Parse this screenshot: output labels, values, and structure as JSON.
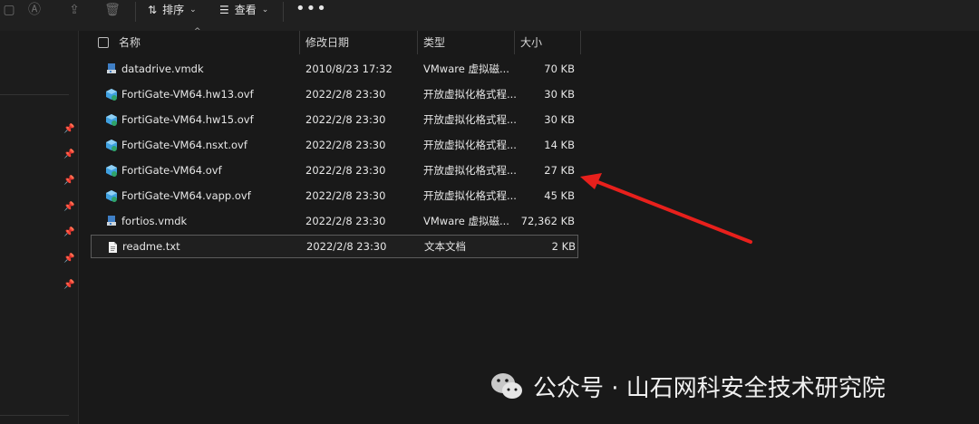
{
  "toolbar": {
    "sort_label": "排序",
    "view_label": "查看",
    "more_label": "•••"
  },
  "columns": {
    "name": "名称",
    "date": "修改日期",
    "type": "类型",
    "size": "大小"
  },
  "files": [
    {
      "name": "datadrive.vmdk",
      "date": "2010/8/23 17:32",
      "type": "VMware 虚拟磁...",
      "size": "70 KB",
      "icon": "vmdk-file-icon"
    },
    {
      "name": "FortiGate-VM64.hw13.ovf",
      "date": "2022/2/8 23:30",
      "type": "开放虚拟化格式程...",
      "size": "30 KB",
      "icon": "ovf-file-icon"
    },
    {
      "name": "FortiGate-VM64.hw15.ovf",
      "date": "2022/2/8 23:30",
      "type": "开放虚拟化格式程...",
      "size": "30 KB",
      "icon": "ovf-file-icon"
    },
    {
      "name": "FortiGate-VM64.nsxt.ovf",
      "date": "2022/2/8 23:30",
      "type": "开放虚拟化格式程...",
      "size": "14 KB",
      "icon": "ovf-file-icon"
    },
    {
      "name": "FortiGate-VM64.ovf",
      "date": "2022/2/8 23:30",
      "type": "开放虚拟化格式程...",
      "size": "27 KB",
      "icon": "ovf-file-icon"
    },
    {
      "name": "FortiGate-VM64.vapp.ovf",
      "date": "2022/2/8 23:30",
      "type": "开放虚拟化格式程...",
      "size": "45 KB",
      "icon": "ovf-file-icon"
    },
    {
      "name": "fortios.vmdk",
      "date": "2022/2/8 23:30",
      "type": "VMware 虚拟磁...",
      "size": "72,362 KB",
      "icon": "vmdk-file-icon"
    },
    {
      "name": "readme.txt",
      "date": "2022/2/8 23:30",
      "type": "文本文档",
      "size": "2 KB",
      "icon": "txt-file-icon"
    }
  ],
  "watermark": {
    "text": "公众号 · 山石网科安全技术研究院"
  },
  "colors": {
    "background": "#191919",
    "toolbar": "#202020",
    "arrow": "#e8201c",
    "ovf_icon": "#3fa0e0"
  }
}
